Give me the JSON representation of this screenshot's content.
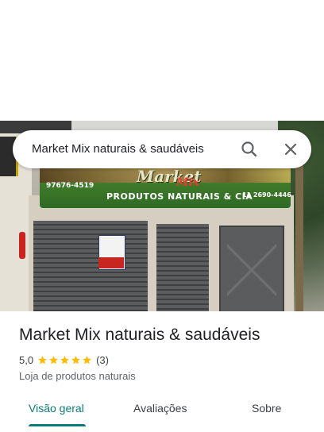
{
  "search": {
    "query": "Market Mix naturais & saudáveis"
  },
  "photo": {
    "sign_phone_left": "97676-4519",
    "sign_brand": "Market",
    "sign_brand_suffix": "Mix",
    "sign_subtitle": "PRODUTOS NATURAIS & CIA",
    "sign_phone_right": "11 2690-4446"
  },
  "place": {
    "title": "Market Mix naturais & saudáveis",
    "rating": "5,0",
    "stars": 5,
    "review_count": "(3)",
    "category": "Loja de produtos naturais"
  },
  "tabs": [
    {
      "label": "Visão geral",
      "active": true
    },
    {
      "label": "Avaliações",
      "active": false
    },
    {
      "label": "Sobre",
      "active": false
    }
  ],
  "colors": {
    "accent": "#0b7a7a",
    "star": "#fbbc04"
  }
}
